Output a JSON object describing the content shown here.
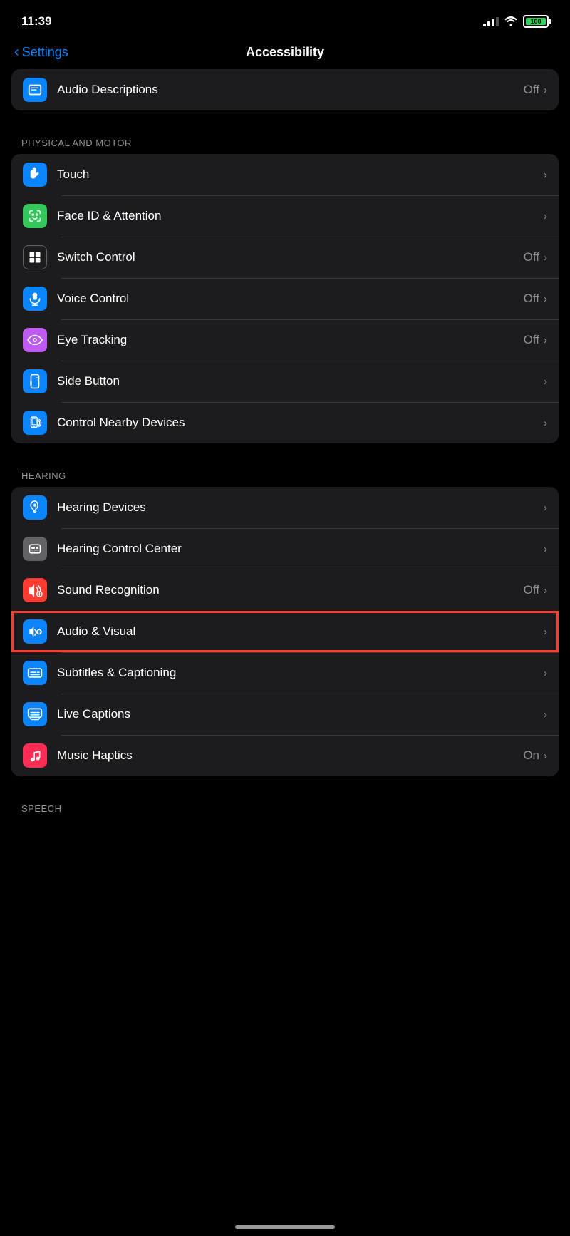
{
  "statusBar": {
    "time": "11:39",
    "battery": "100"
  },
  "nav": {
    "backLabel": "Settings",
    "title": "Accessibility"
  },
  "topGroup": {
    "items": [
      {
        "id": "audio-descriptions",
        "label": "Audio Descriptions",
        "iconBg": "#0a84ff",
        "iconSymbol": "💬",
        "value": "Off",
        "hasChevron": true
      }
    ]
  },
  "sections": [
    {
      "id": "physical-motor",
      "header": "PHYSICAL AND MOTOR",
      "items": [
        {
          "id": "touch",
          "label": "Touch",
          "iconBg": "#0a84ff",
          "iconSymbol": "✋",
          "value": "",
          "hasChevron": true
        },
        {
          "id": "face-id-attention",
          "label": "Face ID & Attention",
          "iconBg": "#34c759",
          "iconSymbol": "🙂",
          "value": "",
          "hasChevron": true
        },
        {
          "id": "switch-control",
          "label": "Switch Control",
          "iconBg": "#1c1c1e",
          "iconSymbol": "⊞",
          "value": "Off",
          "hasChevron": true,
          "iconBorder": "#636366"
        },
        {
          "id": "voice-control",
          "label": "Voice Control",
          "iconBg": "#0a84ff",
          "iconSymbol": "🎙",
          "value": "Off",
          "hasChevron": true
        },
        {
          "id": "eye-tracking",
          "label": "Eye Tracking",
          "iconBg": "#bf5af2",
          "iconSymbol": "👁",
          "value": "Off",
          "hasChevron": true
        },
        {
          "id": "side-button",
          "label": "Side Button",
          "iconBg": "#0a84ff",
          "iconSymbol": "⏐←",
          "value": "",
          "hasChevron": true
        },
        {
          "id": "control-nearby-devices",
          "label": "Control Nearby Devices",
          "iconBg": "#0a84ff",
          "iconSymbol": "📱",
          "value": "",
          "hasChevron": true
        }
      ]
    },
    {
      "id": "hearing",
      "header": "HEARING",
      "items": [
        {
          "id": "hearing-devices",
          "label": "Hearing Devices",
          "iconBg": "#0a84ff",
          "iconSymbol": "👂",
          "value": "",
          "hasChevron": true
        },
        {
          "id": "hearing-control-center",
          "label": "Hearing Control Center",
          "iconBg": "#636366",
          "iconSymbol": "⚙",
          "value": "",
          "hasChevron": true
        },
        {
          "id": "sound-recognition",
          "label": "Sound Recognition",
          "iconBg": "#ff453a",
          "iconSymbol": "🔊",
          "value": "Off",
          "hasChevron": true
        },
        {
          "id": "audio-visual",
          "label": "Audio & Visual",
          "iconBg": "#0a84ff",
          "iconSymbol": "🔈",
          "value": "",
          "hasChevron": true,
          "highlighted": true
        },
        {
          "id": "subtitles-captioning",
          "label": "Subtitles & Captioning",
          "iconBg": "#0a84ff",
          "iconSymbol": "💬",
          "value": "",
          "hasChevron": true
        },
        {
          "id": "live-captions",
          "label": "Live Captions",
          "iconBg": "#0a84ff",
          "iconSymbol": "🎙",
          "value": "",
          "hasChevron": true
        },
        {
          "id": "music-haptics",
          "label": "Music Haptics",
          "iconBg": "#ff2d55",
          "iconSymbol": "🎵",
          "value": "On",
          "hasChevron": true
        }
      ]
    }
  ],
  "bottomSection": {
    "header": "SPEECH"
  }
}
